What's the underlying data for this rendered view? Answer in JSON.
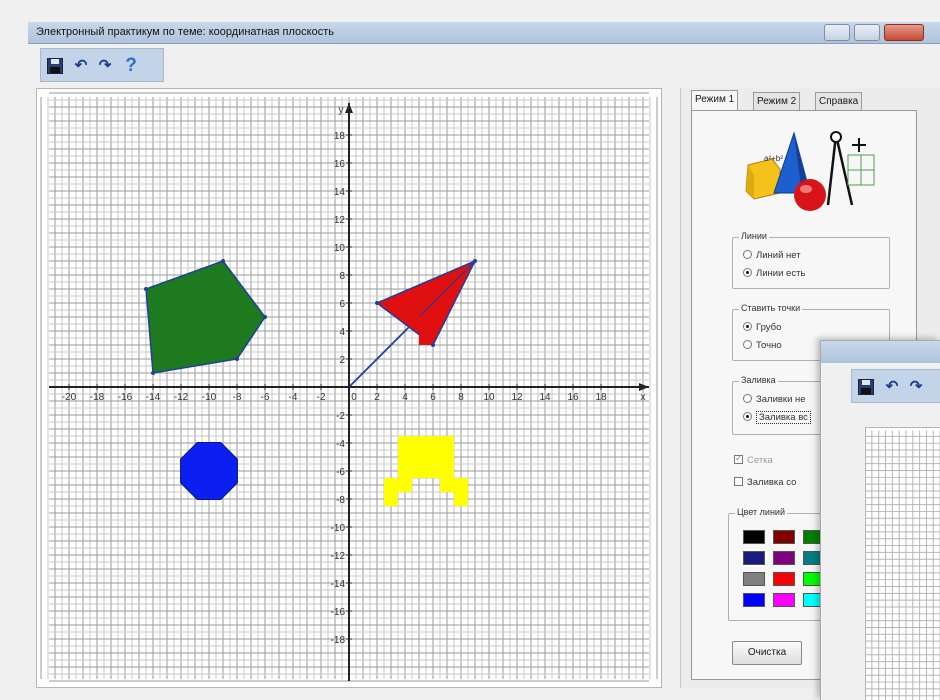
{
  "window": {
    "title": "Электронный практикум по теме: координатная плоскость"
  },
  "icons": {
    "save": "save-icon",
    "undo": "undo-icon",
    "redo": "redo-icon",
    "help": "help-icon"
  },
  "toolbar": {
    "undo_glyph": "↶",
    "redo_glyph": "↷",
    "help_glyph": "?"
  },
  "plot": {
    "x_axis_label": "x",
    "y_axis_label": "y",
    "x_range": [
      -22,
      22
    ],
    "y_range": [
      -20,
      20
    ],
    "x_ticks": [
      -20,
      -18,
      -16,
      -14,
      -12,
      -10,
      -8,
      -6,
      -4,
      -2,
      0,
      2,
      4,
      6,
      8,
      10,
      12,
      14,
      16,
      18
    ],
    "y_ticks": [
      18,
      16,
      14,
      12,
      10,
      8,
      6,
      4,
      2,
      -2,
      -4,
      -6,
      -8,
      -10,
      -12,
      -14,
      -16,
      -18
    ],
    "shapes": {
      "pentagon": {
        "color": "#1e7a1e",
        "points": [
          [
            -14.5,
            7
          ],
          [
            -9,
            9
          ],
          [
            -6,
            5
          ],
          [
            -8,
            2
          ],
          [
            -14,
            1
          ]
        ]
      },
      "arrow": {
        "color": "#e01010",
        "outer": [
          [
            2,
            6
          ],
          [
            9,
            9
          ],
          [
            6,
            3
          ]
        ],
        "inner": [
          [
            2,
            6
          ],
          [
            9,
            9
          ],
          [
            5,
            5
          ]
        ],
        "line_from": [
          0,
          0
        ],
        "line_to": [
          9,
          9
        ],
        "square_points": [
          [
            5,
            4
          ],
          [
            6,
            4
          ],
          [
            6,
            3
          ],
          [
            5,
            3
          ]
        ]
      },
      "octagon": {
        "color": "#0b1ff0",
        "center": [
          -10,
          -6
        ],
        "radius": 2.2
      },
      "blocks": {
        "color": "#ffff00",
        "cells": [
          [
            4,
            -4
          ],
          [
            5,
            -4
          ],
          [
            6,
            -4
          ],
          [
            7,
            -4
          ],
          [
            4,
            -5
          ],
          [
            5,
            -5
          ],
          [
            6,
            -5
          ],
          [
            7,
            -5
          ],
          [
            4,
            -6
          ],
          [
            5,
            -6
          ],
          [
            6,
            -6
          ],
          [
            7,
            -6
          ],
          [
            3,
            -7
          ],
          [
            4,
            -7
          ],
          [
            7,
            -7
          ],
          [
            8,
            -7
          ],
          [
            3,
            -8
          ],
          [
            8,
            -8
          ]
        ]
      }
    }
  },
  "tabs": [
    {
      "label": "Режим 1",
      "active": true
    },
    {
      "label": "Режим 2",
      "active": false
    },
    {
      "label": "Справка",
      "active": false
    }
  ],
  "lines_group": {
    "title": "Линии",
    "options": [
      "Линий нет",
      "Линии есть"
    ],
    "selected": 1
  },
  "points_group": {
    "title": "Ставить точки",
    "options": [
      "Грубо",
      "Точно"
    ],
    "selected": 0
  },
  "fill_group": {
    "title": "Заливка",
    "options": [
      "Заливки не",
      "Заливка вс"
    ],
    "selected": 1
  },
  "checkboxes": {
    "grid_label": "Сетка",
    "fill_color_label": "Заливка со"
  },
  "colors_group": {
    "title": "Цвет линий",
    "swatches": [
      "#000000",
      "#800000",
      "#008000",
      "#1a1a80",
      "#800080",
      "#008080",
      "#808080",
      "#ff0000",
      "#00ff00",
      "#0000ff",
      "#ff00ff",
      "#00ffff"
    ],
    "selected": 3
  },
  "buttons": {
    "clear": "Очистка"
  }
}
